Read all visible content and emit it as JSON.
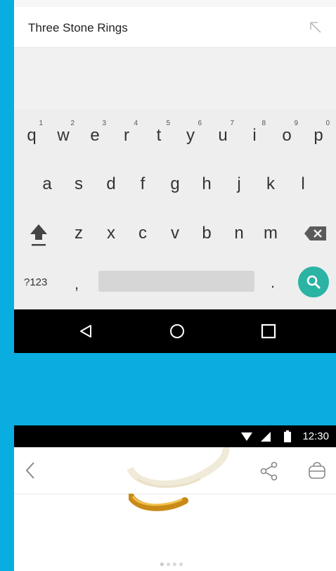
{
  "search": {
    "query": "Three Stone Rings"
  },
  "keyboard": {
    "row1": [
      {
        "key": "q",
        "num": "1"
      },
      {
        "key": "w",
        "num": "2"
      },
      {
        "key": "e",
        "num": "3"
      },
      {
        "key": "r",
        "num": "4"
      },
      {
        "key": "t",
        "num": "5"
      },
      {
        "key": "y",
        "num": "6"
      },
      {
        "key": "u",
        "num": "7"
      },
      {
        "key": "i",
        "num": "8"
      },
      {
        "key": "o",
        "num": "9"
      },
      {
        "key": "p",
        "num": "0"
      }
    ],
    "row2": [
      "a",
      "s",
      "d",
      "f",
      "g",
      "h",
      "j",
      "k",
      "l"
    ],
    "row3": [
      "z",
      "x",
      "c",
      "v",
      "b",
      "n",
      "m"
    ],
    "symbols_key": "?123",
    "comma_key": ",",
    "period_key": "."
  },
  "status": {
    "time": "12:30"
  },
  "colors": {
    "background": "#0aade0",
    "search_button": "#2bb3a4"
  },
  "carousel": {
    "page_count": 4,
    "active_index": 0
  }
}
